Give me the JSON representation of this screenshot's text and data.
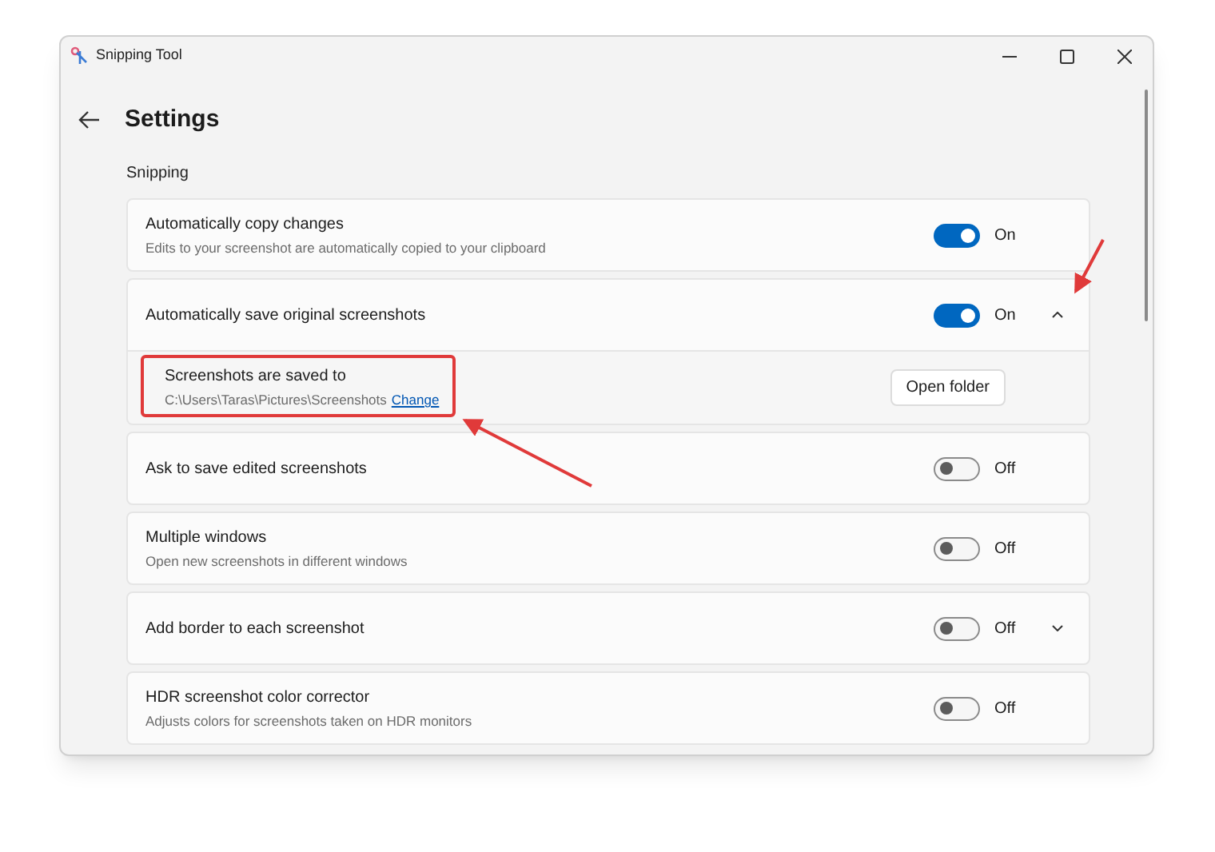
{
  "window": {
    "title": "Snipping Tool"
  },
  "page": {
    "title": "Settings"
  },
  "section": {
    "title": "Snipping"
  },
  "settings": [
    {
      "kind": "toggle",
      "title": "Automatically copy changes",
      "description": "Edits to your screenshot are automatically copied to your clipboard",
      "on": true,
      "state_label": "On"
    },
    {
      "kind": "toggle",
      "title": "Automatically save original screenshots",
      "on": true,
      "state_label": "On",
      "expanded": true,
      "sub": {
        "title": "Screenshots are saved to",
        "path": "C:\\Users\\Taras\\Pictures\\Screenshots",
        "link": "Change",
        "button": "Open folder"
      }
    },
    {
      "kind": "toggle",
      "title": "Ask to save edited screenshots",
      "on": false,
      "state_label": "Off"
    },
    {
      "kind": "toggle",
      "title": "Multiple windows",
      "description": "Open new screenshots in different windows",
      "on": false,
      "state_label": "Off"
    },
    {
      "kind": "toggle",
      "title": "Add border to each screenshot",
      "on": false,
      "state_label": "Off",
      "expanded": false
    },
    {
      "kind": "toggle",
      "title": "HDR screenshot color corrector",
      "description": "Adjusts colors for screenshots taken on HDR monitors",
      "on": false,
      "state_label": "Off"
    }
  ]
}
